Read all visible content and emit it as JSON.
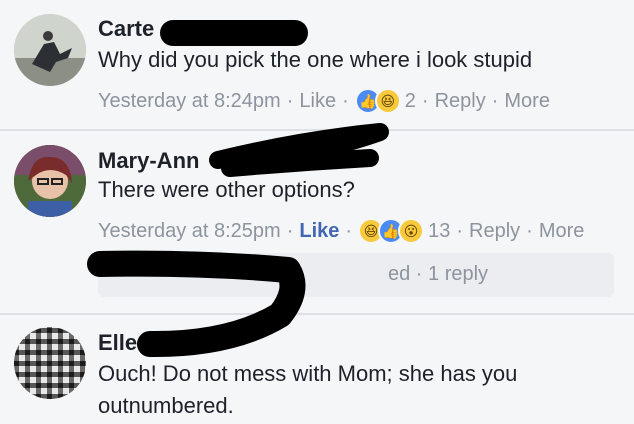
{
  "comments": [
    {
      "author": "Carte",
      "text": "Why did you pick the one where i look stupid",
      "timestamp": "Yesterday at 8:24pm",
      "like_label": "Like",
      "reaction_count": "2",
      "reply_label": "Reply",
      "more_label": "More",
      "reactions": [
        "like-icon",
        "haha-icon"
      ]
    },
    {
      "author": "Mary-Ann",
      "text": "There were other options?",
      "timestamp": "Yesterday at 8:25pm",
      "like_label": "Like",
      "reaction_count": "13",
      "reply_label": "Reply",
      "more_label": "More",
      "reactions": [
        "haha-icon",
        "like-icon",
        "wow-icon"
      ],
      "replies_summary": "ed · 1 reply"
    },
    {
      "author": "Elle",
      "text": "Ouch! Do not mess with Mom; she has you outnumbered."
    }
  ],
  "colors": {
    "background": "#f5f6f7",
    "liked": "#4267b2",
    "meta": "#8d949e",
    "text": "#1d2129"
  }
}
